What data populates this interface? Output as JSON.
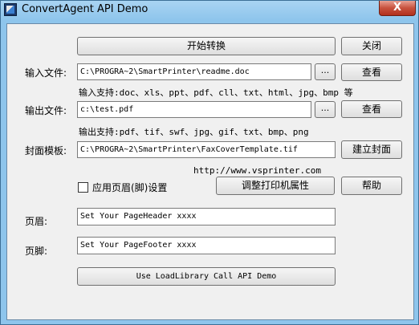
{
  "window": {
    "title": "ConvertAgent API Demo",
    "close_glyph": "X"
  },
  "buttons": {
    "start": "开始转换",
    "close": "关闭",
    "view_input": "查看",
    "view_output": "查看",
    "create_cover": "建立封面",
    "printer_props": "调整打印机属性",
    "help": "帮助",
    "loadlibrary": "Use LoadLibrary Call API Demo",
    "browse_input": "...",
    "browse_output": "..."
  },
  "labels": {
    "input_file": "输入文件:",
    "output_file": "输出文件:",
    "cover_template": "封面模板:",
    "header": "页眉:",
    "footer": "页脚:"
  },
  "hints": {
    "input_support": "输入支持:doc、xls、ppt、pdf、cll、txt、html、jpg、bmp 等",
    "output_support": "输出支持:pdf、tif、swf、jpg、gif、txt、bmp、png",
    "website": "http://www.vsprinter.com"
  },
  "fields": {
    "input_path": "C:\\PROGRA~2\\SmartPrinter\\readme.doc",
    "output_path": "c:\\test.pdf",
    "cover_path": "C:\\PROGRA~2\\SmartPrinter\\FaxCoverTemplate.tif",
    "header_value": "Set Your PageHeader xxxx",
    "footer_value": "Set Your PageFooter xxxx"
  },
  "checkbox": {
    "label": "应用页眉(脚)设置",
    "checked": false
  }
}
